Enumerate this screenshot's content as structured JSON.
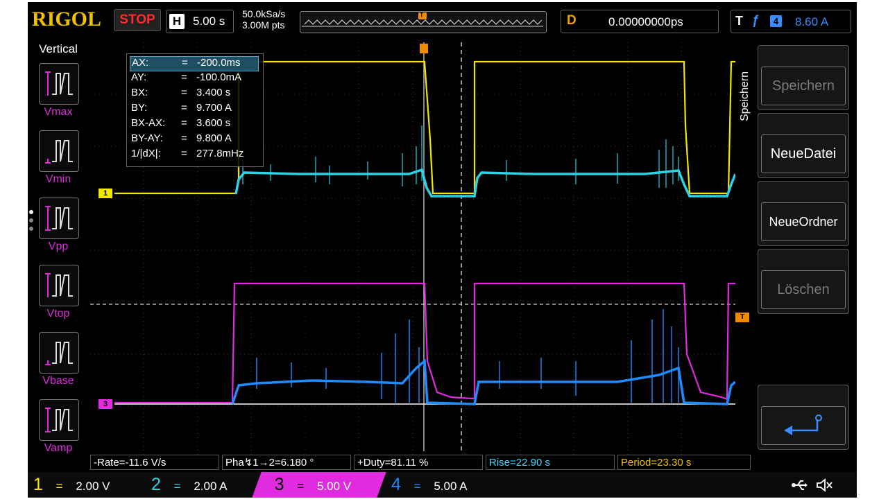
{
  "header": {
    "brand": "RIGOL",
    "run_state": "STOP",
    "horizontal_key": "H",
    "timebase": "5.00 s",
    "sample_rate": "50.0kSa/s",
    "memory_depth": "3.00M pts",
    "trigger_marker": "T",
    "delay_key": "D",
    "delay_value": "0.00000000ps",
    "trigger_key": "T",
    "trigger_source": "4",
    "trigger_level": "8.60 A"
  },
  "left_panel": {
    "title": "Vertical",
    "items": [
      {
        "label": "Vmax"
      },
      {
        "label": "Vmin"
      },
      {
        "label": "Vpp"
      },
      {
        "label": "Vtop"
      },
      {
        "label": "Vbase"
      },
      {
        "label": "Vamp"
      }
    ]
  },
  "cursor_readout": {
    "rows": [
      {
        "name": "AX:",
        "eq": "=",
        "value": "-200.0ms"
      },
      {
        "name": "AY:",
        "eq": "=",
        "value": "-100.0mA"
      },
      {
        "name": "BX:",
        "eq": "=",
        "value": "3.400 s"
      },
      {
        "name": "BY:",
        "eq": "=",
        "value": "9.700 A"
      },
      {
        "name": "BX-AX:",
        "eq": "=",
        "value": "3.600 s"
      },
      {
        "name": "BY-AY:",
        "eq": "=",
        "value": "9.800 A"
      },
      {
        "name": "1/|dX|:",
        "eq": "=",
        "value": "277.8mHz"
      }
    ]
  },
  "channel_markers": {
    "ch1": "1",
    "ch3": "3",
    "trig_level": "T"
  },
  "right_panel": {
    "title": "Speichern",
    "buttons": [
      {
        "label": "Speichern",
        "enabled": false
      },
      {
        "label": "NeueDatei",
        "enabled": true
      },
      {
        "label": "NeueOrdner",
        "enabled": true
      },
      {
        "label": "Löschen",
        "enabled": false
      }
    ],
    "enter_icon": "enter-arrow-icon"
  },
  "measurements": [
    {
      "text": "-Rate=-11.6 V/s",
      "color": "#ffffff"
    },
    {
      "text": "Pha↯1→2=6.180 °",
      "color": "#ffffff"
    },
    {
      "text": "+Duty=81.11 %",
      "color": "#ffffff"
    },
    {
      "text": "Rise=22.90 s",
      "color": "#45d5ff"
    },
    {
      "text": "Period=23.30 s",
      "color": "#f2c200"
    }
  ],
  "channels": [
    {
      "num": "1",
      "coupling": "=",
      "scale": "2.00 V",
      "color": "#f2e600"
    },
    {
      "num": "2",
      "coupling": "=",
      "scale": "2.00 A",
      "color": "#2cd3e6"
    },
    {
      "num": "3",
      "coupling": "=",
      "scale": "5.00 V",
      "color": "#e02be0"
    },
    {
      "num": "4",
      "coupling": "=",
      "scale": "5.00 A",
      "color": "#2f6fff"
    }
  ],
  "status_icons": [
    "usb-icon",
    "speaker-mute-icon"
  ],
  "colors": {
    "ch1": "#f2e600",
    "ch2": "#2cd3e6",
    "ch3": "#e02be0",
    "ch4": "#1e8cff",
    "brand": "#f2c200",
    "stop": "#ff2a2a"
  }
}
